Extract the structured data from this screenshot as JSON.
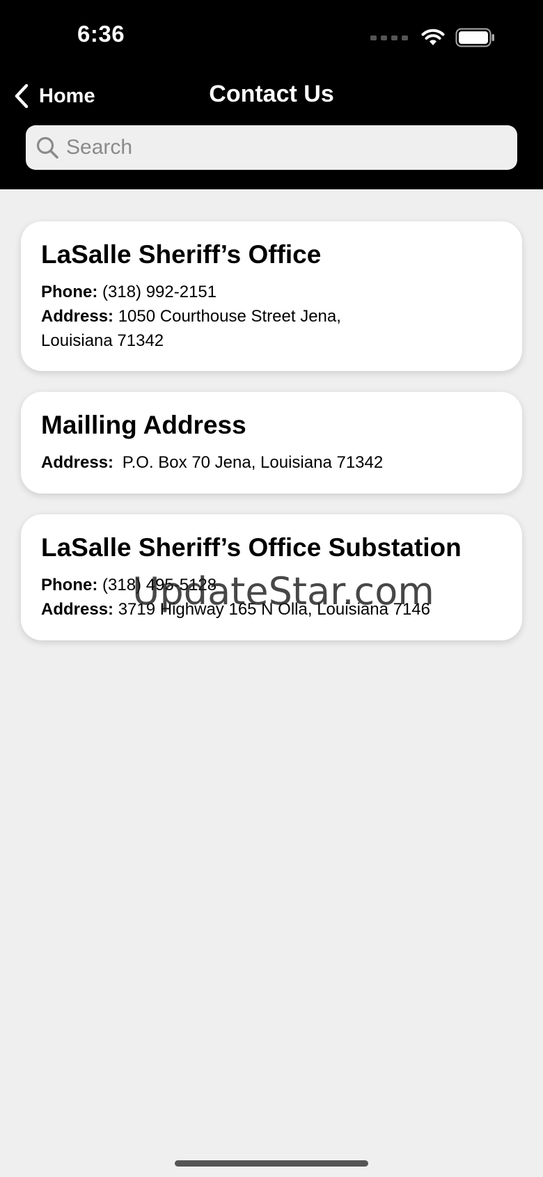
{
  "status_bar": {
    "time": "6:36"
  },
  "nav": {
    "back_label": "Home",
    "title": "Contact Us"
  },
  "search": {
    "placeholder": "Search"
  },
  "cards": [
    {
      "title": "LaSalle Sheriff’s Office",
      "phone_label": "Phone:",
      "phone": "(318) 992-2151",
      "address_label": "Address:",
      "address_line1": "1050 Courthouse Street Jena,",
      "address_line2": "Louisiana 71342"
    },
    {
      "title": "Mailling Address",
      "address_label": "Address:",
      "address_line1": "P.O. Box 70 Jena, Louisiana 71342"
    },
    {
      "title": "LaSalle Sheriff’s Office Substation",
      "phone_label": "Phone:",
      "phone": "(318) 495-5128",
      "address_label": "Address:",
      "address_line1": "3719 Highway 165 N Olla, Louisiana 7146"
    }
  ],
  "watermark": "UpdateStar.com"
}
